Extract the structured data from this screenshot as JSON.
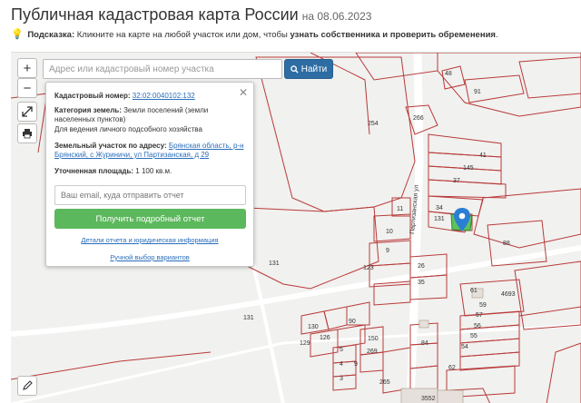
{
  "header": {
    "title": "Публичная кадастровая карта России",
    "date": "на 08.06.2023"
  },
  "hint": {
    "label": "Подсказка:",
    "text": "Кликните на карте на любой участок или дом, чтобы",
    "emphasis": "узнать собственника и проверить обременения",
    "end": "."
  },
  "search": {
    "placeholder": "Адрес или кадастровый номер участка",
    "button_label": "Найти"
  },
  "controls": {
    "zoom_in": "+",
    "zoom_out": "−"
  },
  "popup": {
    "cadastral_label": "Кадастровый номер:",
    "cadastral_value": "32:02:0040102:132",
    "category_label": "Категория земель:",
    "category_value": "Земли поселений (земли населенных пунктов)",
    "usage": "Для ведения личного подсобного хозяйства",
    "address_label": "Земельный участок по адресу:",
    "address_value_1": "Брянская область, р-н",
    "address_value_2": "Брянский, с Журиничи, ул Партизанская, д 29",
    "area_label": "Уточненная площадь:",
    "area_value": "1 100 кв.м.",
    "email_placeholder": "Ваш email, куда отправить отчет",
    "report_button": "Получить подробный отчет",
    "details_link": "Детали отчета и юридическая информация",
    "manual_link": "Ручной выбор вариантов"
  },
  "map": {
    "street_label": "Партизанская ул",
    "parcel_labels": [
      "48",
      "91",
      "266",
      "254",
      "41",
      "145",
      "37",
      "34",
      "131",
      "11",
      "10",
      "88",
      "9",
      "123",
      "26",
      "35",
      "131",
      "131",
      "61",
      "4693",
      "59",
      "57",
      "56",
      "55",
      "54",
      "62",
      "90",
      "130",
      "129",
      "126",
      "5",
      "4",
      "3",
      "150",
      "269",
      "84",
      "265",
      "3552",
      "9"
    ],
    "colors": {
      "parcel_border": "#b83a3a",
      "selected_fill": "#5ec15e",
      "background": "#f1f1ef",
      "road": "#ffffff"
    }
  }
}
